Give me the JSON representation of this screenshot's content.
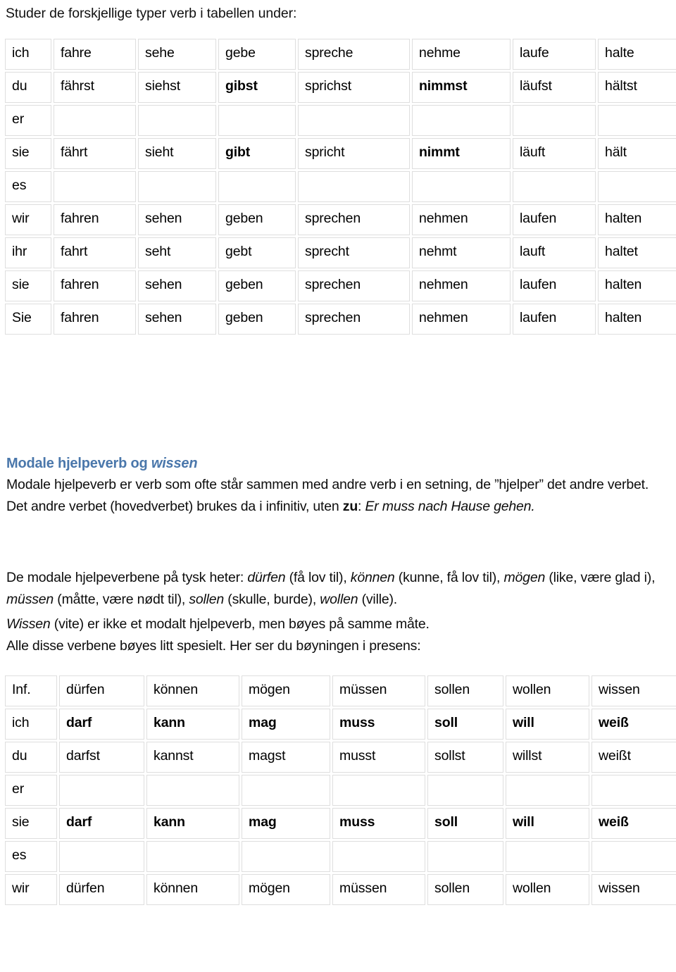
{
  "document": {
    "intro_line": "Studer de forskjellige typer verb i tabellen under:"
  },
  "verb_table": {
    "name": "strong-verb-present-tense-table",
    "columns": 8,
    "rows": [
      {
        "cells": [
          "ich",
          "fahre",
          "sehe",
          "gebe",
          "spreche",
          "nehme",
          "laufe",
          "halte"
        ],
        "bold": [
          false,
          false,
          false,
          false,
          false,
          false,
          false,
          false
        ]
      },
      {
        "cells": [
          "du",
          "fährst",
          "siehst",
          "gibst",
          "sprichst",
          "nimmst",
          "läufst",
          "hältst"
        ],
        "bold": [
          false,
          false,
          false,
          true,
          false,
          true,
          false,
          false
        ]
      },
      {
        "cells": [
          "er",
          "",
          "",
          "",
          "",
          "",
          "",
          ""
        ],
        "bold": [
          false,
          false,
          false,
          false,
          false,
          false,
          false,
          false
        ]
      },
      {
        "cells": [
          "sie",
          "fährt",
          "sieht",
          "gibt",
          "spricht",
          "nimmt",
          "läuft",
          "hält"
        ],
        "bold": [
          false,
          false,
          false,
          true,
          false,
          true,
          false,
          false
        ]
      },
      {
        "cells": [
          "es",
          "",
          "",
          "",
          "",
          "",
          "",
          ""
        ],
        "bold": [
          false,
          false,
          false,
          false,
          false,
          false,
          false,
          false
        ]
      },
      {
        "cells": [
          "wir",
          "fahren",
          "sehen",
          "geben",
          "sprechen",
          "nehmen",
          "laufen",
          "halten"
        ],
        "bold": [
          false,
          false,
          false,
          false,
          false,
          false,
          false,
          false
        ]
      },
      {
        "cells": [
          "ihr",
          "fahrt",
          "seht",
          "gebt",
          "sprecht",
          "nehmt",
          "lauft",
          "haltet"
        ],
        "bold": [
          false,
          false,
          false,
          false,
          false,
          false,
          false,
          false
        ]
      },
      {
        "cells": [
          "sie",
          "fahren",
          "sehen",
          "geben",
          "sprechen",
          "nehmen",
          "laufen",
          "halten"
        ],
        "bold": [
          false,
          false,
          false,
          false,
          false,
          false,
          false,
          false
        ]
      },
      {
        "cells": [
          "Sie",
          "fahren",
          "sehen",
          "geben",
          "sprechen",
          "nehmen",
          "laufen",
          "halten"
        ],
        "bold": [
          false,
          false,
          false,
          false,
          false,
          false,
          false,
          false
        ]
      }
    ]
  },
  "section": {
    "heading_plain": "Modale hjelpeverb og ",
    "heading_italic": "wissen",
    "heading_color": "#4a77ab",
    "definition": {
      "part1": "Modale hjelpeverb er verb som ofte står sammen med andre verb i en setning, de ”hjelper” det andre verbet. Det andre verbet (hovedverbet) brukes da i infinitiv, uten ",
      "zu": "zu",
      "part2": ": ",
      "example": "Er muss nach Hause gehen."
    },
    "list_line": {
      "lead": "De modale hjelpeverbene på tysk heter: ",
      "v1": "dürfen",
      "g1": " (få lov til), ",
      "v2": "können",
      "g2": " (kunne, få lov til), ",
      "v3": "mögen",
      "g3": " (like, være glad i), ",
      "v4": "müssen",
      "g4": " (måtte, være nødt til), ",
      "v5": "sollen",
      "g5": " (skulle, burde), ",
      "v6": "wollen",
      "g6": " (ville)."
    },
    "wissen_line": {
      "italic": "Wissen",
      "rest": " (vite) er ikke et modalt hjelpeverb, men bøyes på samme måte."
    },
    "presens_line": "Alle disse verbene bøyes litt spesielt. Her ser du bøyningen i presens:"
  },
  "modal_table": {
    "name": "modal-verb-present-tense-table",
    "columns": 8,
    "rows": [
      {
        "cells": [
          "Inf.",
          "dürfen",
          "können",
          "mögen",
          "müssen",
          "sollen",
          "wollen",
          "wissen"
        ],
        "bold": [
          false,
          false,
          false,
          false,
          false,
          false,
          false,
          false
        ]
      },
      {
        "cells": [
          "ich",
          "darf",
          "kann",
          "mag",
          "muss",
          "soll",
          "will",
          "weiß"
        ],
        "bold": [
          false,
          true,
          true,
          true,
          true,
          true,
          true,
          true
        ]
      },
      {
        "cells": [
          "du",
          "darfst",
          "kannst",
          "magst",
          "musst",
          "sollst",
          "willst",
          "weißt"
        ],
        "bold": [
          false,
          false,
          false,
          false,
          false,
          false,
          false,
          false
        ]
      },
      {
        "cells": [
          "er",
          "",
          "",
          "",
          "",
          "",
          "",
          ""
        ],
        "bold": [
          false,
          false,
          false,
          false,
          false,
          false,
          false,
          false
        ]
      },
      {
        "cells": [
          "sie",
          "darf",
          "kann",
          "mag",
          "muss",
          "soll",
          "will",
          "weiß"
        ],
        "bold": [
          false,
          true,
          true,
          true,
          true,
          true,
          true,
          true
        ]
      },
      {
        "cells": [
          "es",
          "",
          "",
          "",
          "",
          "",
          "",
          ""
        ],
        "bold": [
          false,
          false,
          false,
          false,
          false,
          false,
          false,
          false
        ]
      },
      {
        "cells": [
          "wir",
          "dürfen",
          "können",
          "mögen",
          "müssen",
          "sollen",
          "wollen",
          "wissen"
        ],
        "bold": [
          false,
          false,
          false,
          false,
          false,
          false,
          false,
          false
        ]
      }
    ]
  }
}
